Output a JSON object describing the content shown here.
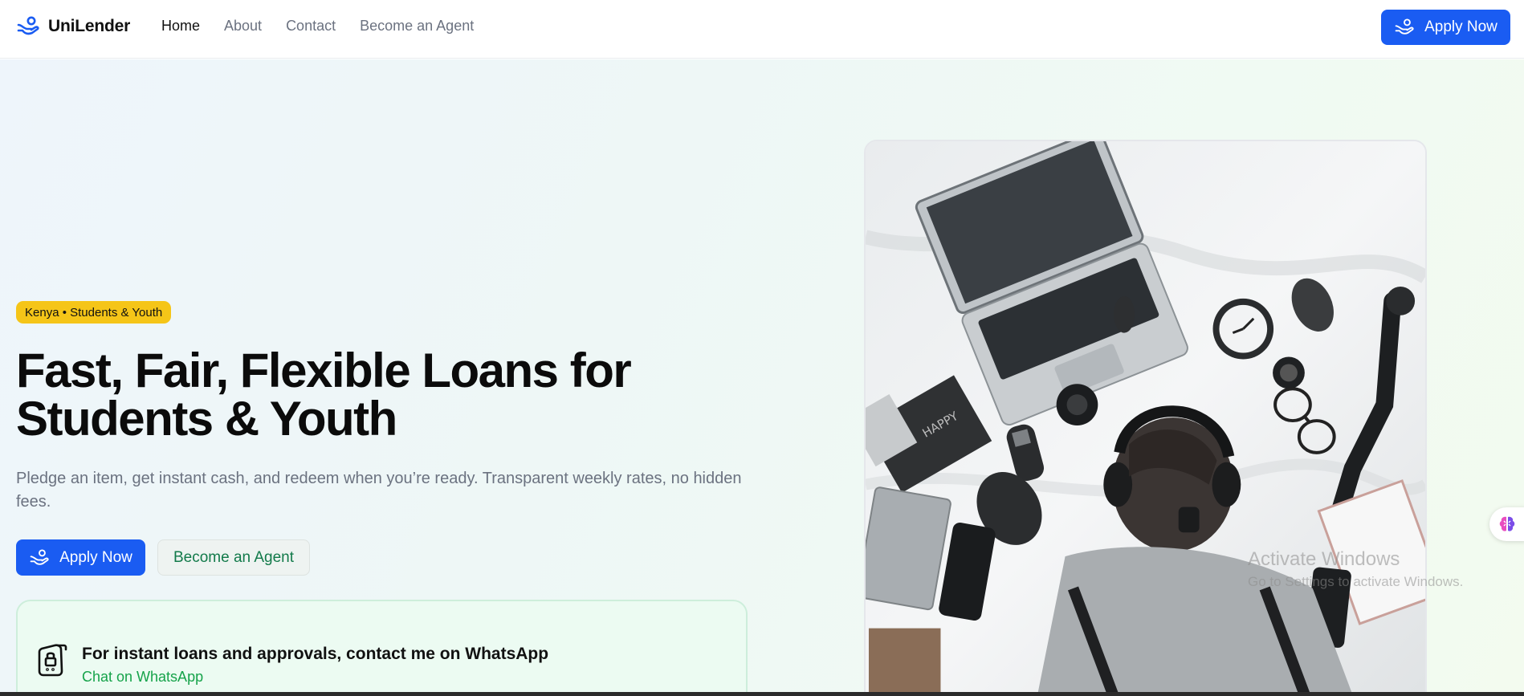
{
  "brand": {
    "name": "UniLender",
    "icon": "hand-coin-icon",
    "color": "#1a5cf2"
  },
  "nav": {
    "links": [
      {
        "label": "Home",
        "active": true
      },
      {
        "label": "About",
        "active": false
      },
      {
        "label": "Contact",
        "active": false
      },
      {
        "label": "Become an Agent",
        "active": false
      }
    ],
    "apply_label": "Apply Now"
  },
  "hero": {
    "badge": "Kenya • Students & Youth",
    "title": "Fast, Fair, Flexible Loans for Students & Youth",
    "subtitle": "Pledge an item, get instant cash, and redeem when you’re ready. Transparent weekly rates, no hidden fees.",
    "apply_label": "Apply Now",
    "agent_label": "Become an Agent"
  },
  "whatsapp": {
    "title": "For instant loans and approvals, contact me on WhatsApp",
    "link_label": "Chat on WhatsApp",
    "icon": "phone-lock-icon"
  },
  "overlay": {
    "activate_title": "Activate Windows",
    "activate_sub": "Go to Settings to activate Windows."
  },
  "colors": {
    "primary": "#1a5cf2",
    "badge": "#f5c518",
    "whatsapp": "#16a34a",
    "agent_text": "#127a4a"
  }
}
